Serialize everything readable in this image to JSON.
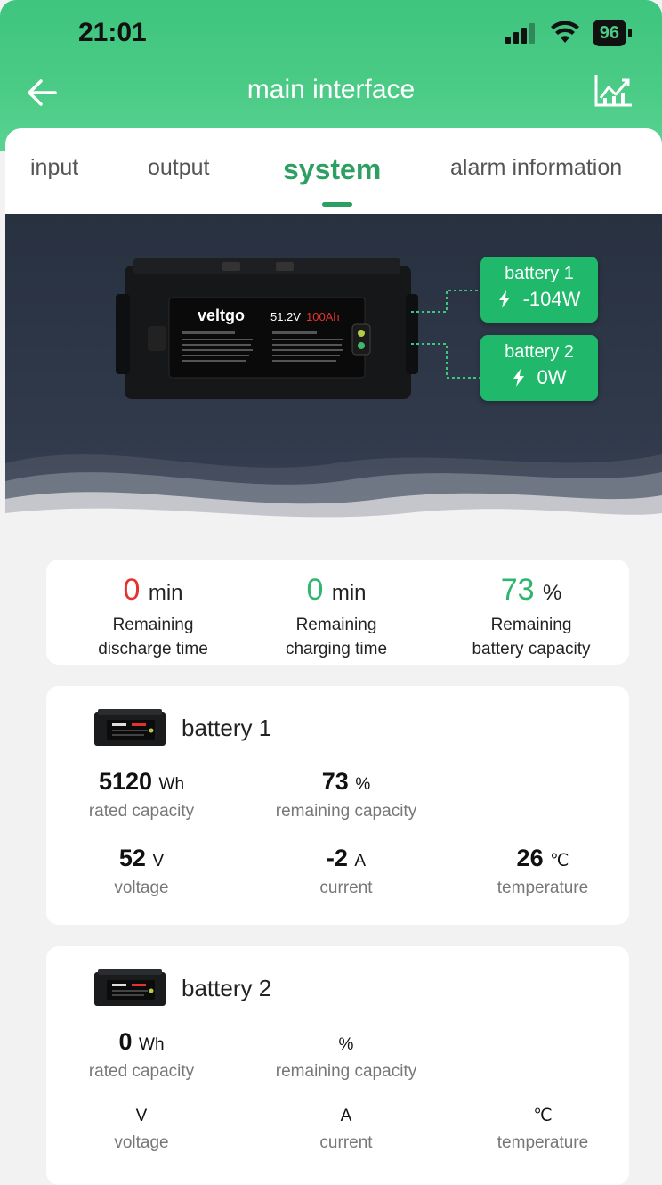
{
  "status_bar": {
    "time": "21:01",
    "battery_level": "96"
  },
  "header": {
    "title": "main interface"
  },
  "tabs": [
    {
      "label": "input"
    },
    {
      "label": "output"
    },
    {
      "label": "system"
    },
    {
      "label": "alarm information"
    }
  ],
  "hero": {
    "product_brand": "veltgo",
    "product_spec_voltage": "51.2V",
    "product_spec_capacity": "100Ah",
    "batteries": [
      {
        "name": "battery 1",
        "power": "-104W"
      },
      {
        "name": "battery 2",
        "power": "0W"
      }
    ]
  },
  "summary": {
    "discharge": {
      "value": "0",
      "unit": "min",
      "label_1": "Remaining",
      "label_2": "discharge time"
    },
    "charging": {
      "value": "0",
      "unit": "min",
      "label_1": "Remaining",
      "label_2": "charging time"
    },
    "capacity": {
      "value": "73",
      "unit": "%",
      "label_1": "Remaining",
      "label_2": "battery capacity"
    }
  },
  "battery_cards": [
    {
      "name": "battery 1",
      "rated_capacity": {
        "value": "5120",
        "unit": "Wh",
        "label": "rated capacity"
      },
      "remaining_capacity": {
        "value": "73",
        "unit": "%",
        "label": "remaining capacity"
      },
      "voltage": {
        "value": "52",
        "unit": "V",
        "label": "voltage"
      },
      "current": {
        "value": "-2",
        "unit": "A",
        "label": "current"
      },
      "temperature": {
        "value": "26",
        "unit": "℃",
        "label": "temperature"
      }
    },
    {
      "name": "battery 2",
      "rated_capacity": {
        "value": "0",
        "unit": "Wh",
        "label": "rated capacity"
      },
      "remaining_capacity": {
        "value": "",
        "unit": "%",
        "label": "remaining capacity"
      },
      "voltage": {
        "value": "",
        "unit": "V",
        "label": "voltage"
      },
      "current": {
        "value": "",
        "unit": "A",
        "label": "current"
      },
      "temperature": {
        "value": "",
        "unit": "℃",
        "label": "temperature"
      }
    }
  ],
  "colors": {
    "accent": "#2e9f62",
    "header_green": "#4bcb86",
    "tag_green": "#20b86a",
    "alert_red": "#e5322d"
  }
}
